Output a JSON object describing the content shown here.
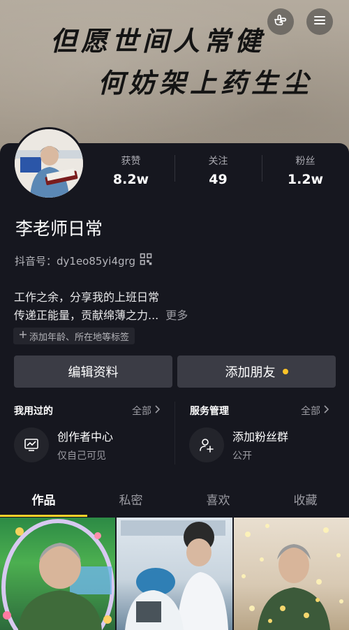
{
  "banner": {
    "line1": "但愿世间人常健",
    "line2": "何妨架上药生尘"
  },
  "header": {
    "gesture_icon": "hand-pointer-icon",
    "menu_icon": "hamburger-menu-icon"
  },
  "stats": [
    {
      "label": "获赞",
      "value": "8.2w"
    },
    {
      "label": "关注",
      "value": "49"
    },
    {
      "label": "粉丝",
      "value": "1.2w"
    }
  ],
  "profile": {
    "name": "李老师日常",
    "douyin_id": "抖音号：dy1eo85yi4grg",
    "bio_line1": "工作之余，分享我的上班日常",
    "bio_line2": "传递正能量，贡献绵薄之力...",
    "more": "更多",
    "tag_hint": "添加年龄、所在地等标签"
  },
  "actions": {
    "edit": "编辑资料",
    "add_friend": "添加朋友",
    "dot_color": "#ffc428"
  },
  "used": {
    "title": "我用过的",
    "all": "全部",
    "item_title": "创作者中心",
    "item_sub": "仅自己可见"
  },
  "services": {
    "title": "服务管理",
    "all": "全部",
    "item_title": "添加粉丝群",
    "item_sub": "公开"
  },
  "tabs": [
    "作品",
    "私密",
    "喜欢",
    "收藏"
  ],
  "accent": "#ffd32a"
}
